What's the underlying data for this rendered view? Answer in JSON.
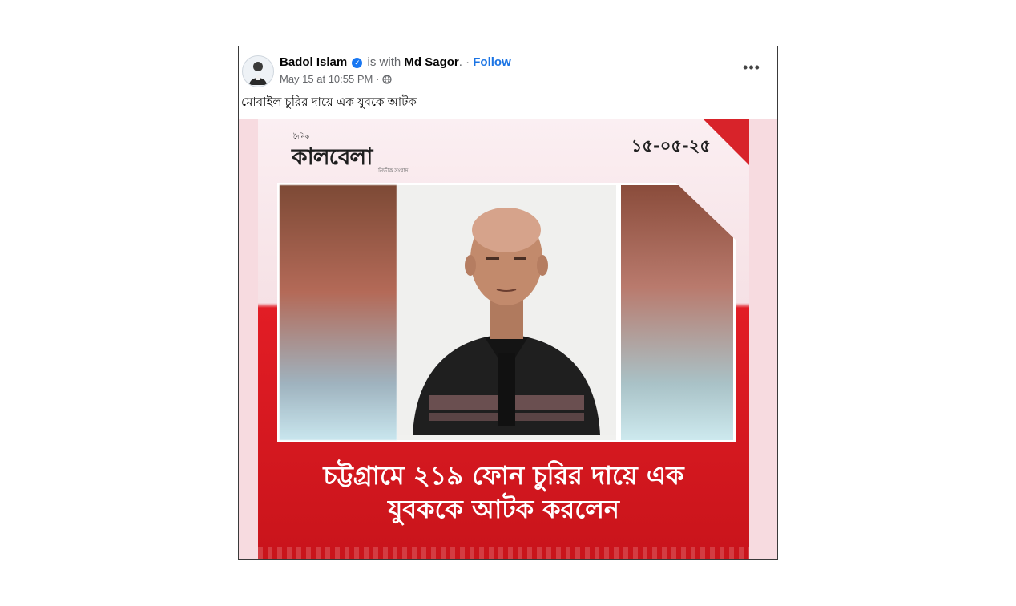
{
  "post": {
    "author": "Badol Islam",
    "is_with_text": "is with",
    "tagged_person": "Md Sagor",
    "separator": ". ·",
    "follow_label": "Follow",
    "timestamp": "May 15 at 10:55 PM ·",
    "caption": "মোবাইল চুরির দায়ে এক যুবকে আটক",
    "more_label": "•••"
  },
  "image": {
    "brand_small": "দৈনিক",
    "brand_name": "কালবেলা",
    "brand_tagline": "নির্ভীক সংবাদ",
    "date": "১৫-০৫-২৫",
    "headline_line1": "চট্টগ্রামে ২১৯ ফোন চুরির দায়ে এক",
    "headline_line2": "যুবককে আটক করলেন"
  },
  "colors": {
    "follow": "#1b74e4",
    "verified": "#1877f2",
    "banner_red": "#d8232a"
  }
}
